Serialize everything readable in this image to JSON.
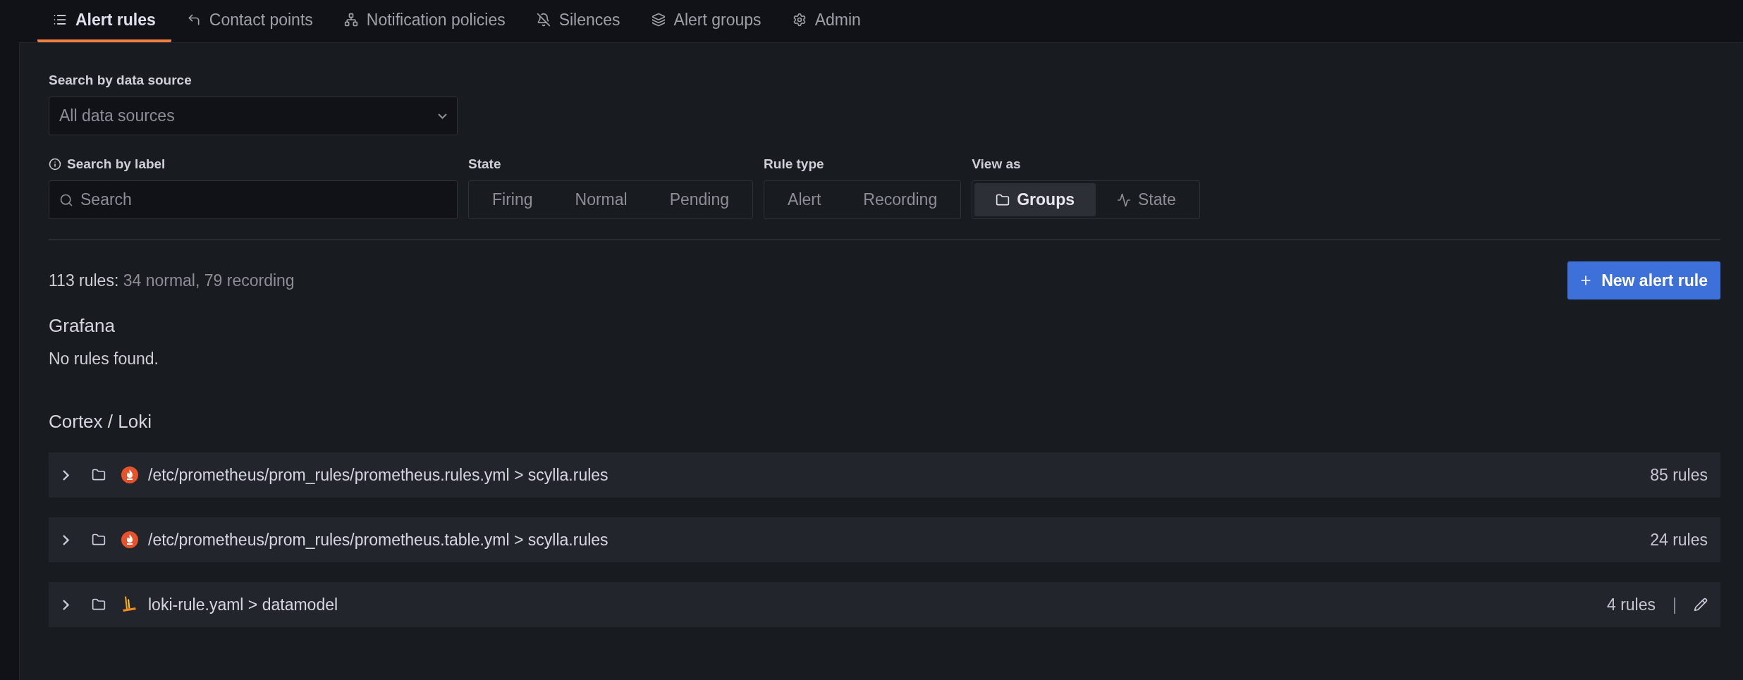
{
  "tabs": [
    {
      "label": "Alert rules",
      "selected": true
    },
    {
      "label": "Contact points",
      "selected": false
    },
    {
      "label": "Notification policies",
      "selected": false
    },
    {
      "label": "Silences",
      "selected": false
    },
    {
      "label": "Alert groups",
      "selected": false
    },
    {
      "label": "Admin",
      "selected": false
    }
  ],
  "datasource_filter": {
    "label": "Search by data source",
    "placeholder": "All data sources"
  },
  "label_filter": {
    "label": "Search by label",
    "placeholder": "Search"
  },
  "state_filter": {
    "label": "State",
    "options": [
      {
        "label": "Firing",
        "selected": false
      },
      {
        "label": "Normal",
        "selected": false
      },
      {
        "label": "Pending",
        "selected": false
      }
    ]
  },
  "rule_type_filter": {
    "label": "Rule type",
    "options": [
      {
        "label": "Alert",
        "selected": false
      },
      {
        "label": "Recording",
        "selected": false
      }
    ]
  },
  "view_as": {
    "label": "View as",
    "options": [
      {
        "label": "Groups",
        "kind": "folder",
        "selected": true
      },
      {
        "label": "State",
        "kind": "activity",
        "selected": false
      }
    ]
  },
  "summary": [
    {
      "text": "113 rules: ",
      "muted": false
    },
    {
      "text": "34 normal,",
      "muted": true
    },
    {
      "text": " 79 recording",
      "muted": true
    }
  ],
  "new_rule_button": "New alert rule",
  "sections": [
    {
      "title": "Grafana",
      "empty_text": "No rules found."
    },
    {
      "title": "Cortex / Loki",
      "groups": [
        {
          "kind": "prometheus",
          "name": "/etc/prometheus/prom_rules/prometheus.rules.yml > scylla.rules",
          "count": "85 rules",
          "expanded": false,
          "editable": false
        },
        {
          "kind": "prometheus",
          "name": "/etc/prometheus/prom_rules/prometheus.table.yml > scylla.rules",
          "count": "24 rules",
          "expanded": false,
          "editable": false
        },
        {
          "kind": "loki",
          "name": "loki-rule.yaml > datamodel",
          "count": "4 rules",
          "separator": "|",
          "expanded": false,
          "editable": true
        }
      ]
    }
  ]
}
